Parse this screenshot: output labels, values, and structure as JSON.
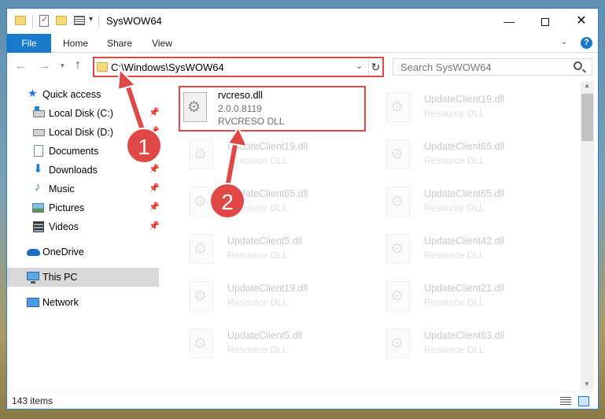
{
  "window": {
    "title": "SysWOW64",
    "controls": {
      "minimize": "—",
      "maximize": "",
      "close": "✕"
    }
  },
  "ribbon": {
    "tabs": [
      {
        "label": "File"
      },
      {
        "label": "Home"
      },
      {
        "label": "Share"
      },
      {
        "label": "View"
      }
    ],
    "help": "?"
  },
  "nav": {
    "address": "C:\\Windows\\SysWOW64",
    "search_placeholder": "Search SysWOW64"
  },
  "sidebar": {
    "items": [
      {
        "label": "Quick access",
        "icon": "star-icon"
      },
      {
        "label": "Local Disk (C:)",
        "icon": "drive-icon",
        "pinned": true
      },
      {
        "label": "Local Disk (D:)",
        "icon": "drive-icon",
        "pinned": true
      },
      {
        "label": "Documents",
        "icon": "documents-icon",
        "pinned": true
      },
      {
        "label": "Downloads",
        "icon": "downloads-icon",
        "pinned": true
      },
      {
        "label": "Music",
        "icon": "music-icon",
        "pinned": true
      },
      {
        "label": "Pictures",
        "icon": "pictures-icon",
        "pinned": true
      },
      {
        "label": "Videos",
        "icon": "videos-icon",
        "pinned": true
      },
      {
        "label": "OneDrive",
        "icon": "onedrive-icon"
      },
      {
        "label": "This PC",
        "icon": "pc-icon"
      },
      {
        "label": "Network",
        "icon": "network-icon"
      }
    ]
  },
  "files": {
    "highlighted": {
      "name": "rvcreso.dll",
      "version": "2.0.0.8119",
      "description": "RVCRESO DLL"
    },
    "tiles": [
      {
        "name": "UpdateClient19.dll",
        "type": "Resource DLL"
      },
      {
        "name": "UpdateClient19.dll",
        "type": "Resource DLL"
      },
      {
        "name": "UpdateClient65.dll",
        "type": "Resource DLL"
      },
      {
        "name": "UpdateClient65.dll",
        "type": "Resource DLL"
      },
      {
        "name": "UpdateClient65.dll",
        "type": "Resource DLL"
      },
      {
        "name": "UpdateClient5.dll",
        "type": "Resource DLL"
      },
      {
        "name": "UpdateClient42.dll",
        "type": "Resource DLL"
      },
      {
        "name": "UpdateClient19.dll",
        "type": "Resource DLL"
      },
      {
        "name": "UpdateClient21.dll",
        "type": "Resource DLL"
      },
      {
        "name": "UpdateClient5.dll",
        "type": "Resource DLL"
      },
      {
        "name": "UpdateClient63.dll",
        "type": "Resource DLL"
      }
    ]
  },
  "status": {
    "item_count": "143 items"
  },
  "annotations": {
    "step1": "1",
    "step2": "2"
  },
  "colors": {
    "accent": "#1979ca",
    "highlight": "#e04848"
  }
}
